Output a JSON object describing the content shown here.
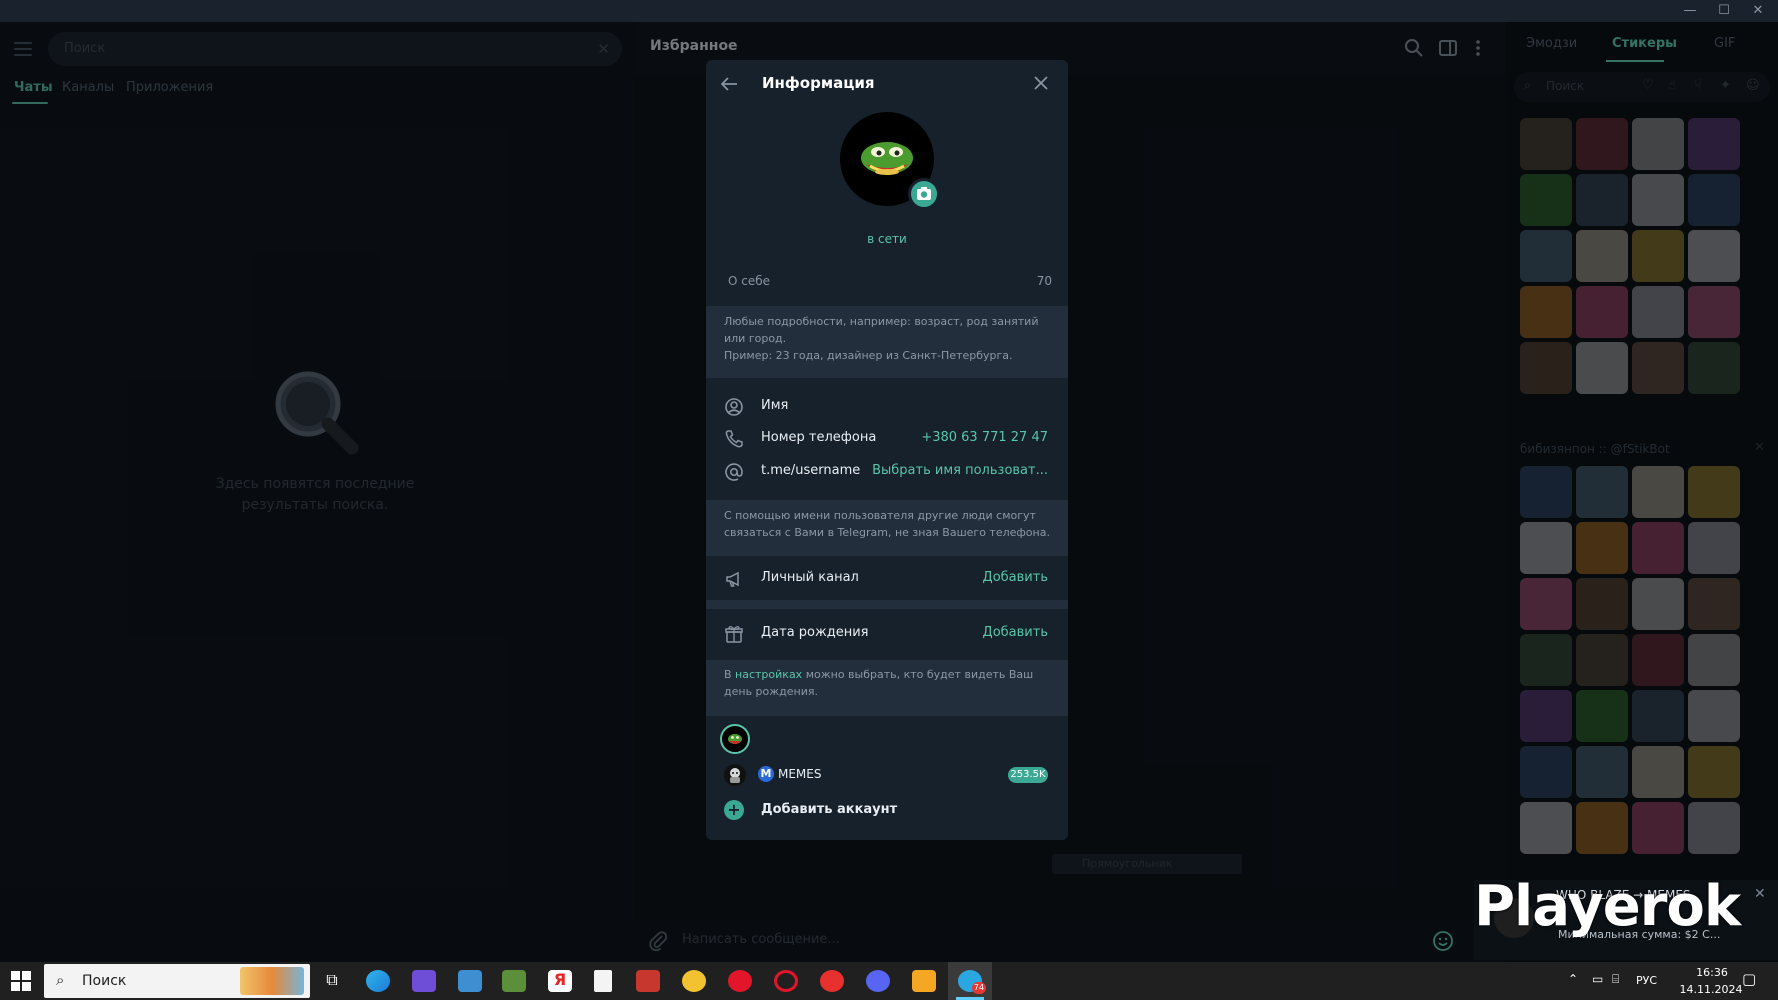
{
  "left_panel": {
    "search_placeholder": "Поиск",
    "tabs": [
      "Чаты",
      "Каналы",
      "Приложения"
    ],
    "empty_text": "Здесь появятся последние результаты поиска."
  },
  "chat": {
    "title": "Избранное",
    "composer_placeholder": "Написать сообщение...",
    "bubble_text": "Прямоугольник"
  },
  "sticker_panel": {
    "tabs": [
      "Эмодзи",
      "Стикеры",
      "GIF"
    ],
    "search_placeholder": "Поиск",
    "pack_title": "бибизянпон :: @fStikBot"
  },
  "dialog": {
    "title": "Информация",
    "status": "в сети",
    "about_label": "О себе",
    "about_count": "70",
    "about_hint_lines": [
      "Любые подробности, например: возраст, род занятий",
      "или город.",
      "Пример: 23 года, дизайнер из Санкт-Петербурга."
    ],
    "rows": {
      "name": {
        "label": "Имя",
        "value": ""
      },
      "phone": {
        "label": "Номер телефона",
        "value": "+380 63 771 27 47"
      },
      "username": {
        "label": "t.me/username",
        "value": "Выбрать имя пользоват..."
      }
    },
    "username_hint_lines": [
      "С помощью имени пользователя другие люди смогут",
      "связаться с Вами в Telegram, не зная Вашего телефона."
    ],
    "channel": {
      "label": "Личный канал",
      "action": "Добавить"
    },
    "birthday": {
      "label": "Дата рождения",
      "action": "Добавить"
    },
    "birthday_hint": {
      "prefix": "В ",
      "link": "настройках",
      "suffix": " можно выбрать, кто будет видеть Ваш",
      "line2": "день рождения."
    },
    "accounts": [
      {
        "name": "MEMES",
        "badge": "253.5K",
        "letter": "M"
      }
    ],
    "add_account": "Добавить аккаунт"
  },
  "promo": {
    "watermark": "Playerok",
    "title": "WHO BLAZE → MEMES",
    "sum": "Минимальная сумма: $2  С..."
  },
  "taskbar": {
    "search": "Поиск",
    "lang": "РУС",
    "time": "16:36",
    "date": "14.11.2024",
    "telegram_badge": "74"
  },
  "colors": {
    "accent": "#5ac5a9",
    "dialog_bg": "#17212b",
    "hint_bg": "#232e3c"
  }
}
